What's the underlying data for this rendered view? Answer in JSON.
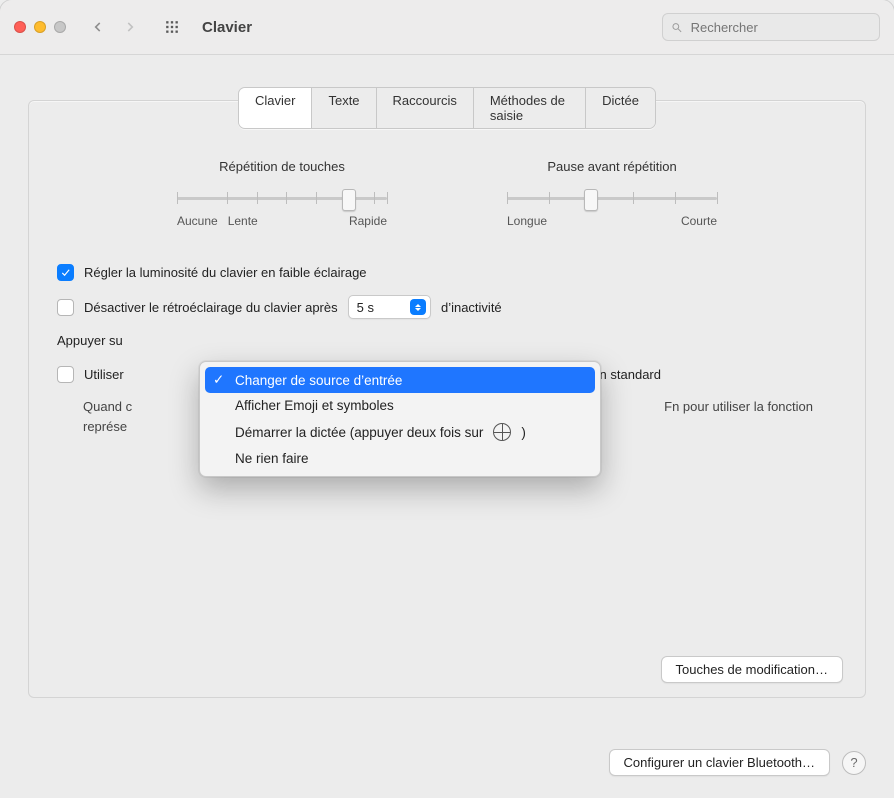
{
  "window": {
    "title": "Clavier"
  },
  "search": {
    "placeholder": "Rechercher"
  },
  "tabs": [
    "Clavier",
    "Texte",
    "Raccourcis",
    "Méthodes de saisie",
    "Dictée"
  ],
  "active_tab": 0,
  "sliders": {
    "key_repeat": {
      "title": "Répétition de touches",
      "left": "Aucune",
      "mid": "Lente",
      "right": "Rapide"
    },
    "delay": {
      "title": "Pause avant répétition",
      "left": "Longue",
      "right": "Courte"
    }
  },
  "opts": {
    "adjust_brightness": "Régler la luminosité du clavier en faible éclairage",
    "turn_off_prefix": "Désactiver le rétroéclairage du clavier après",
    "turn_off_value": "5 s",
    "turn_off_suffix": "d’inactivité",
    "press_prefix": "Appuyer su",
    "use_fn_partial": "Utiliser",
    "use_fn_suffix": "ion standard",
    "fn_hint_prefix": "Quand c",
    "fn_hint_suffix": "Fn pour utiliser la fonction",
    "fn_hint_line2": "représe"
  },
  "menu": {
    "items": [
      "Changer de source d’entrée",
      "Afficher Emoji et symboles",
      "Démarrer la dictée (appuyer deux fois sur",
      "Ne rien faire"
    ],
    "dictation_tail": ")"
  },
  "buttons": {
    "modifier_keys": "Touches de modification…",
    "setup_bluetooth": "Configurer un clavier Bluetooth…",
    "help": "?"
  }
}
